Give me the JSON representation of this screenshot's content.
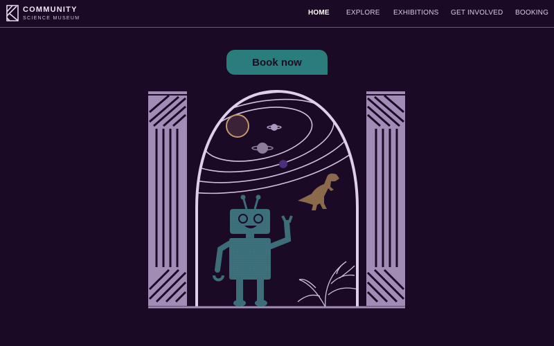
{
  "brand": {
    "name_line1": "COMMUNITY",
    "name_line2": "SCIENCE  MUSEUM",
    "logo_icon": "museum-logo-icon"
  },
  "nav": {
    "items": [
      {
        "label": "HOME",
        "active": true
      },
      {
        "label": "EXPLORE",
        "active": false
      },
      {
        "label": "EXHIBITIONS",
        "active": false
      },
      {
        "label": "GET INVOLVED",
        "active": false
      },
      {
        "label": "BOOKING",
        "active": false
      }
    ]
  },
  "hero": {
    "cta_label": "Book now",
    "illustration_icons": [
      "column-icon",
      "solar-system-icon",
      "t-rex-icon",
      "robot-icon",
      "fern-icon"
    ]
  },
  "colors": {
    "background": "#1b0a26",
    "accent_teal": "#2a7d7c",
    "arch_outline": "#ddd0ec",
    "column_fill": "#a08cb4",
    "robot": "#3b6e78",
    "dinosaur": "#8a6a4a"
  }
}
